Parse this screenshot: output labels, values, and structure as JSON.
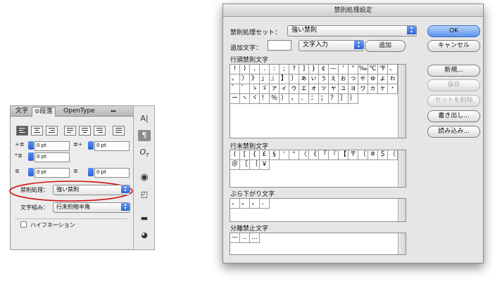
{
  "panel": {
    "tabs": [
      "文字",
      "段落",
      "OpenType"
    ],
    "tab_chevron": "≎",
    "menu_glyph": "▸▸",
    "indent_left": "0 pt",
    "indent_right": "0 pt",
    "indent_first": "0 pt",
    "space_before": "0 pt",
    "space_after": "0 pt",
    "kinsoku_label": "禁則処理：",
    "kinsoku_value": "強い禁則",
    "mojikumi_label": "文字組み：",
    "mojikumi_value": "行末約物半角",
    "hyphenation_label": "ハイフネーション",
    "highlight_color": "#d01010"
  },
  "dialog": {
    "title": "禁則処理設定",
    "set_label": "禁則処理セット：",
    "set_value": "強い禁則",
    "add_label": "追加文字：",
    "add_input_value": "",
    "input_mode": "文字入力",
    "add_button": "追加",
    "ok_button": "OK",
    "cancel_button": "キャンセル",
    "new_button": "新規...",
    "save_button": "保存",
    "delete_set_button": "セットを削除",
    "export_button": "書き出し...",
    "import_button": "読み込み...",
    "sections": [
      {
        "label": "行頭禁則文字",
        "rows": [
          [
            "!",
            ")",
            ",",
            ".",
            ":",
            ";",
            "?",
            "]",
            "}",
            "¢",
            "—",
            "’",
            "”",
            "‰",
            "℃",
            "℉"
          ],
          [
            "、",
            "。",
            "〉",
            "》",
            "」",
            "』",
            "】",
            "〕",
            "ぁ",
            "ぃ",
            "ぅ",
            "ぇ",
            "ぉ",
            "っ",
            "ゃ",
            "ゅ"
          ],
          [
            "ょ",
            "ゎ",
            "゛",
            "゜",
            "ゝ",
            "ゞ",
            "ァ",
            "ィ",
            "ゥ",
            "ェ",
            "ォ",
            "ッ",
            "ャ",
            "ュ",
            "ョ",
            "ヮ"
          ],
          [
            "ヵ",
            "ヶ",
            "・",
            "ー",
            "ヽ",
            "ヾ",
            "！",
            "％",
            "）",
            "，",
            "．",
            "：",
            "；",
            "？",
            "］",
            "｝"
          ]
        ]
      },
      {
        "label": "行末禁則文字",
        "rows": [
          [
            "(",
            "[",
            "{",
            "£",
            "§",
            "‘",
            "“",
            "〈",
            "《",
            "「",
            "『",
            "【",
            "〒",
            "〔",
            "＃",
            "＄"
          ],
          [
            "（",
            "＠",
            "［",
            "｛",
            "￥"
          ]
        ]
      },
      {
        "label": "ぶら下がり文字",
        "rows": [
          [
            "、",
            "。",
            "，",
            "．"
          ]
        ]
      },
      {
        "label": "分離禁止文字",
        "rows": [
          [
            "—",
            "‥",
            "…"
          ]
        ]
      }
    ]
  }
}
